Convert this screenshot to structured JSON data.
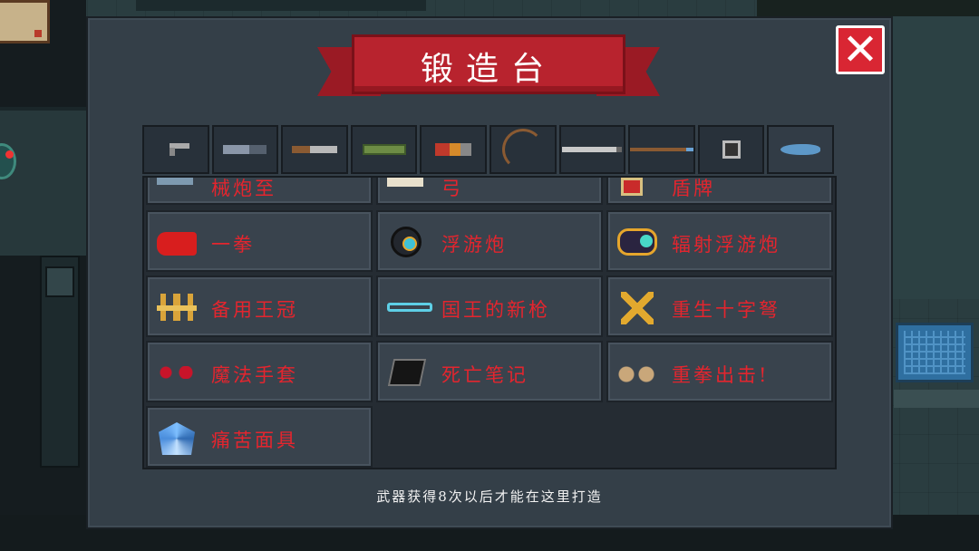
{
  "window": {
    "title": "锻造台",
    "close_label": "✕",
    "footer_text": "武器获得8次以后才能在这里打造"
  },
  "tabs": [
    {
      "name": "pistol",
      "icon": "pistol-icon",
      "active": false
    },
    {
      "name": "rifle",
      "icon": "rifle-icon",
      "active": false
    },
    {
      "name": "shotgun",
      "icon": "shotgun-icon",
      "active": false
    },
    {
      "name": "rocket",
      "icon": "rocket-launcher-icon",
      "active": false
    },
    {
      "name": "launcher",
      "icon": "launcher-icon",
      "active": false
    },
    {
      "name": "bow",
      "icon": "bow-icon",
      "active": false
    },
    {
      "name": "sword",
      "icon": "sword-icon",
      "active": false
    },
    {
      "name": "spear",
      "icon": "spear-icon",
      "active": false
    },
    {
      "name": "shuriken",
      "icon": "shuriken-icon",
      "active": false
    },
    {
      "name": "fish",
      "icon": "fish-icon",
      "active": true
    }
  ],
  "items": {
    "partial_row": [
      "械炮至",
      "弓",
      "盾牌"
    ],
    "row1": [
      "一拳",
      "浮游炮",
      "辐射浮游炮"
    ],
    "row2": [
      "备用王冠",
      "国王的新枪",
      "重生十字弩"
    ],
    "row3": [
      "魔法手套",
      "死亡笔记",
      "重拳出击!"
    ],
    "row4": [
      "痛苦面具"
    ]
  }
}
